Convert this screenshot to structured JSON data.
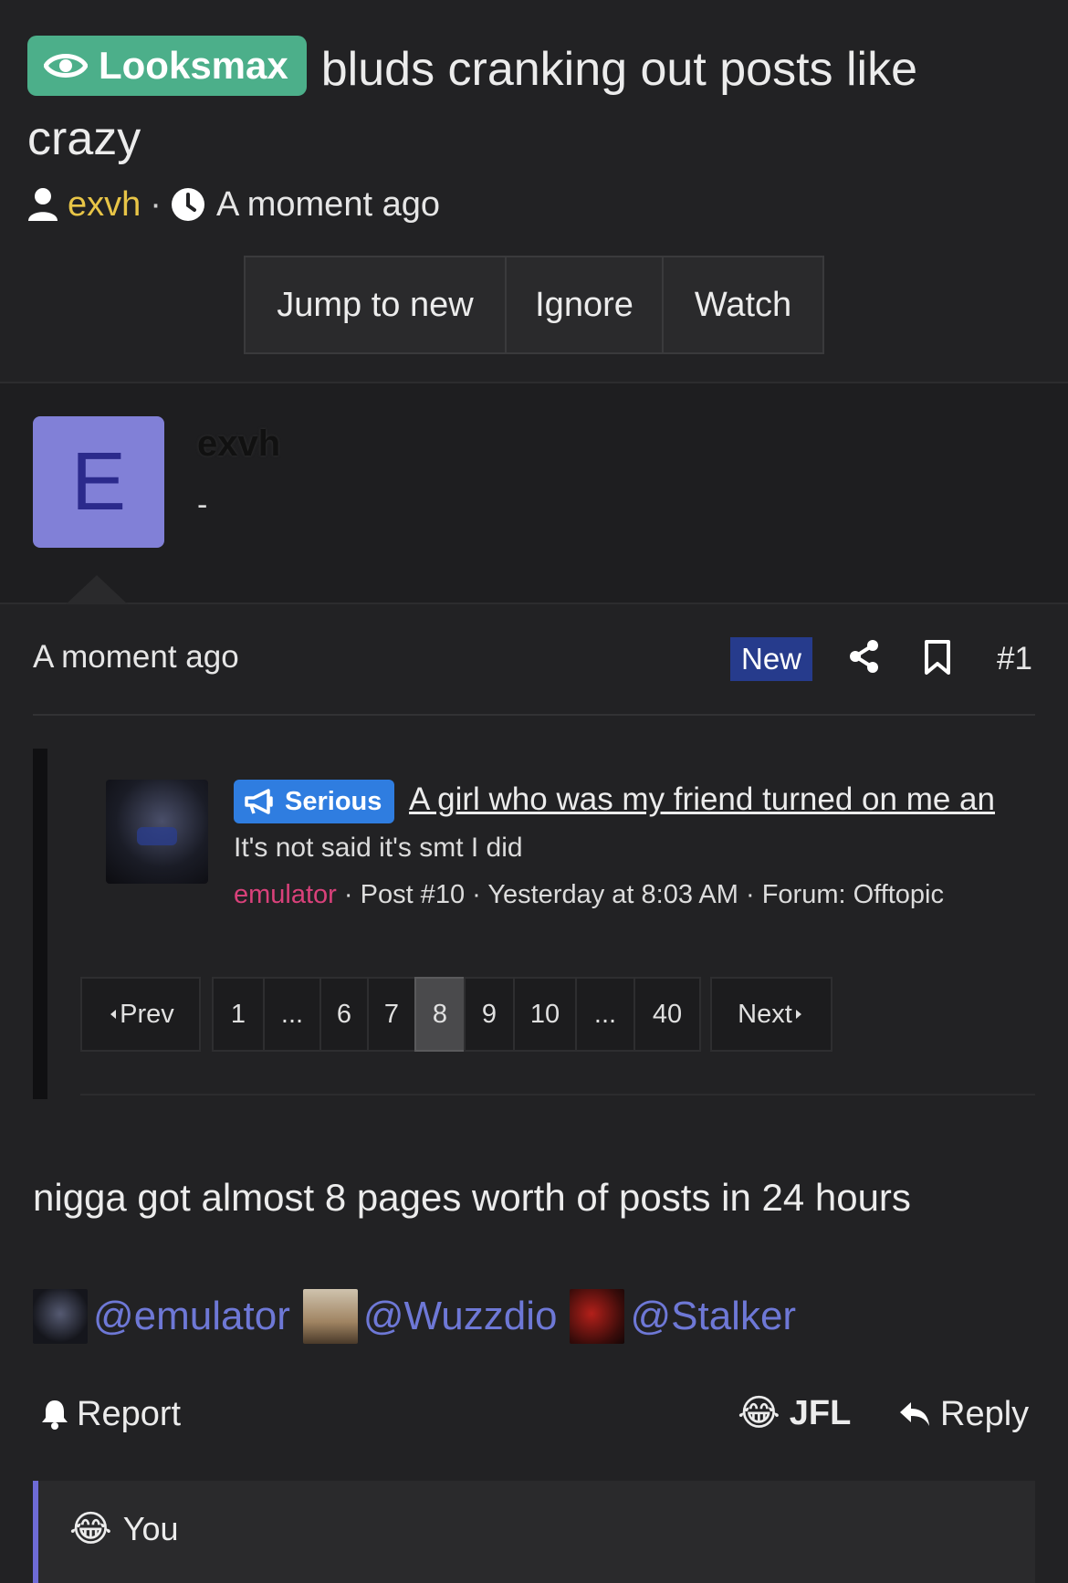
{
  "thread": {
    "prefix": "Looksmax",
    "title": "bluds cranking out posts like crazy",
    "author": "exvh",
    "separator": "·",
    "time": "A moment ago"
  },
  "actions": {
    "jump_to_new": "Jump to new",
    "ignore": "Ignore",
    "watch": "Watch"
  },
  "post": {
    "avatar_letter": "E",
    "username": "exvh",
    "user_title": "-",
    "time": "A moment ago",
    "new_badge": "New",
    "number": "#1",
    "embed": {
      "prefix": "Serious",
      "title": "A girl who was my friend turned on me an",
      "snippet": "It's not said it's smt I did",
      "author": "emulator",
      "meta_rest": " · Post #10 · Yesterday at 8:03 AM · Forum: Offtopic"
    },
    "pagination": {
      "prev": "Prev",
      "next": "Next",
      "pages": [
        "1",
        "...",
        "6",
        "7",
        "8",
        "9",
        "10",
        "...",
        "40"
      ],
      "current": "8"
    },
    "body": "nigga got almost 8 pages worth of posts in 24 hours",
    "mentions": [
      "@emulator",
      "@Wuzzdio",
      "@Stalker"
    ],
    "report": "Report",
    "jfl": "JFL",
    "reply": "Reply",
    "reactions_user": "You"
  },
  "colors": {
    "background": "#222224",
    "prefix_badge": "#4caf8a",
    "author": "#e8c547",
    "new_badge": "#263b8c",
    "serious_badge": "#2f7de0",
    "mention": "#6e78d6",
    "accent_bar": "#6e6bd6"
  },
  "icons": [
    "eye-icon",
    "user-icon",
    "clock-icon",
    "share-icon",
    "bookmark-icon",
    "megaphone-icon",
    "bell-icon",
    "reply-arrow-icon",
    "crying-laughing-emoji"
  ]
}
